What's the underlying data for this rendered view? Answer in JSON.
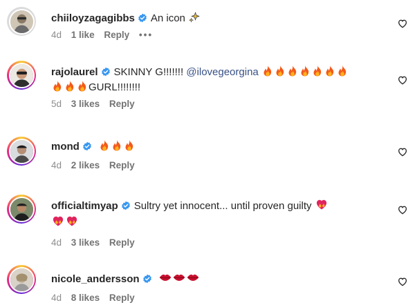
{
  "comments": [
    {
      "username": "chiiloyzagagibbs",
      "text": "An icon",
      "emoji": "sparkles",
      "time": "4d",
      "likes": "1 like",
      "reply": "Reply",
      "more": "•••"
    },
    {
      "username": "rajolaurel",
      "text": "SKINNY G!!!!!!! ",
      "mention": "@ilovegeorgina",
      "emoji": "fire",
      "text2": "GURL!!!!!!!!",
      "time": "5d",
      "likes": "3 likes",
      "reply": "Reply"
    },
    {
      "username": "mond",
      "emoji": "fire",
      "time": "4d",
      "likes": "2 likes",
      "reply": "Reply"
    },
    {
      "username": "officialtimyap",
      "text": "Sultry yet innocent... until proven guilty",
      "emoji": "heart-on-fire",
      "time": "4d",
      "likes": "3 likes",
      "reply": "Reply"
    },
    {
      "username": "nicole_andersson",
      "emoji": "lips",
      "time": "4d",
      "likes": "8 likes",
      "reply": "Reply"
    }
  ],
  "colors": {
    "verified": "#3897f0",
    "meta": "#8e8e8e",
    "mention": "#385185",
    "fire": "#f25a1b"
  }
}
